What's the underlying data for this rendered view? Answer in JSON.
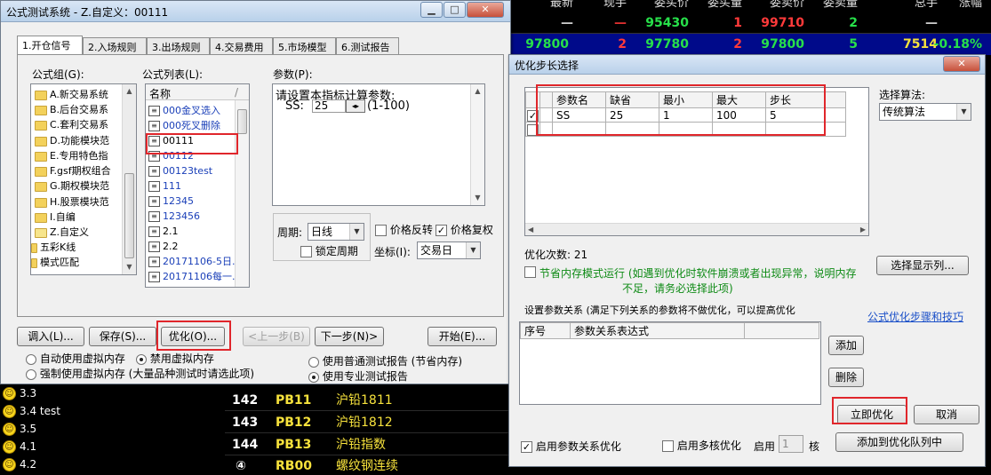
{
  "market_header": {
    "columns": [
      "最新",
      "现手",
      "委买价",
      "委买量",
      "委卖价",
      "委卖量",
      "总手",
      "涨幅"
    ],
    "row1": [
      "—",
      "—",
      "95430",
      "1",
      "99710",
      "2",
      "—",
      ""
    ],
    "row2": [
      "97800",
      "2",
      "97780",
      "2",
      "97800",
      "5",
      "7514",
      "-0.18%"
    ]
  },
  "left_list": [
    {
      "label": "3.3"
    },
    {
      "label": "3.4 test"
    },
    {
      "label": "3.5"
    },
    {
      "label": "4.1"
    },
    {
      "label": "4.2"
    }
  ],
  "quotes": [
    {
      "no": "142",
      "code": "PB11",
      "name": "沪铅1811"
    },
    {
      "no": "143",
      "code": "PB12",
      "name": "沪铅1812"
    },
    {
      "no": "144",
      "code": "PB13",
      "name": "沪铅指数"
    },
    {
      "no": "④",
      "code": "RB00",
      "name": "螺纹钢连续"
    }
  ],
  "main_dialog": {
    "title": "公式测试系统 - Z.自定义：00111",
    "tabs": [
      "1.开仓信号",
      "2.入场规则",
      "3.出场规则",
      "4.交易费用",
      "5.市场模型",
      "6.测试报告"
    ],
    "group_label": "公式组(G):",
    "groups": [
      "A.新交易系统",
      "B.后台交易系",
      "C.套利交易系",
      "D.功能模块范",
      "E.专用特色指",
      "F.gsf期权组合",
      "G.期权模块范",
      "H.股票模块范",
      "I.自编",
      "Z.自定义",
      "五彩K线",
      "模式匹配"
    ],
    "list_label": "公式列表(L):",
    "list_header_name": "名称",
    "list_header_sep": "/",
    "formulas": [
      "000金叉选入",
      "000死叉删除",
      "00111",
      "00112",
      "00123test",
      "111",
      "12345",
      "123456",
      "2.1",
      "2.2",
      "20171106-5日...",
      "20171106每一..."
    ],
    "params_label": "参数(P):",
    "params_hint": "请设置本指标计算参数:",
    "param_name": "SS:",
    "param_value": "25",
    "param_range": "(1-100)",
    "period_label": "周期:",
    "period_value": "日线",
    "lock_period": "锁定周期",
    "price_reverse": "价格反转",
    "price_restore": "价格复权",
    "coord_label": "坐标(I):",
    "coord_value": "交易日",
    "buttons": {
      "load": "调入(L)...",
      "save": "保存(S)...",
      "optimize": "优化(O)...",
      "prev": "<上一步(B)",
      "next": "下一步(N)>",
      "start": "开始(E)..."
    },
    "mem_auto": "自动使用虚拟内存",
    "mem_disable": "禁用虚拟内存",
    "mem_force": "强制使用虚拟内存 (大量品种测试时请选此项)",
    "report_normal": "使用普通测试报告 (节省内存)",
    "report_pro": "使用专业测试报告"
  },
  "opt_dialog": {
    "title": "优化步长选择",
    "table_headers": [
      "参数名",
      "缺省",
      "最小",
      "最大",
      "步长"
    ],
    "table_rows": [
      {
        "checked": true,
        "name": "SS",
        "default": "25",
        "min": "1",
        "max": "100",
        "step": "5"
      }
    ],
    "algo_label": "选择算法:",
    "algo_value": "传统算法",
    "opt_count": "优化次数: 21",
    "mem_mode_line1": "节省内存模式运行 (如遇到优化时软件崩溃或者出现异常，说明内存",
    "mem_mode_line2": "不足，请务必选择此项)",
    "select_cols_button": "选择显示列...",
    "relation_label": "设置参数关系 (满足下列关系的参数将不做优化，可以提高优化",
    "tips_link": "公式优化步骤和技巧",
    "rel_headers": [
      "序号",
      "参数关系表达式"
    ],
    "add_button": "添加",
    "delete_button": "删除",
    "optimize_now_button": "立即优化",
    "cancel_button": "取消",
    "enable_relation": "启用参数关系优化",
    "enable_multicore": "启用多核优化",
    "enable_label": "启用",
    "core_value": "1",
    "core_label": "核",
    "add_queue_button": "添加到优化队列中"
  }
}
